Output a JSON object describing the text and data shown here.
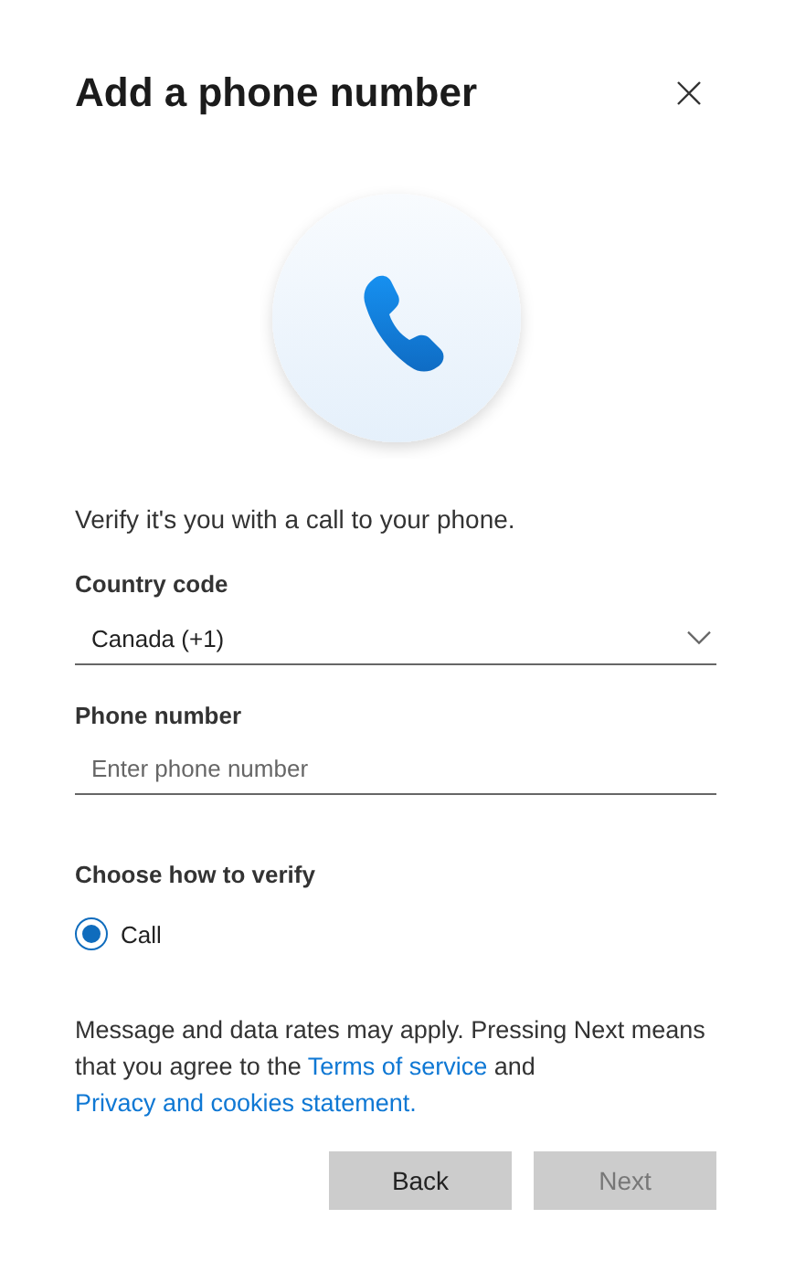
{
  "dialog": {
    "title": "Add a phone number"
  },
  "intro": "Verify it's you with a call to your phone.",
  "country": {
    "label": "Country code",
    "value": "Canada (+1)"
  },
  "phone": {
    "label": "Phone number",
    "placeholder": "Enter phone number"
  },
  "verify": {
    "label": "Choose how to verify",
    "options": [
      {
        "label": "Call",
        "selected": true
      }
    ]
  },
  "legal": [
    {
      "kind": "text",
      "text": "Message and data rates may apply. Pressing Next means that you agree to the "
    },
    {
      "kind": "link",
      "text": "Terms of service"
    },
    {
      "kind": "text",
      "text": " and "
    },
    {
      "kind": "link",
      "text": "Privacy and cookies statement."
    }
  ],
  "buttons": [
    {
      "label": "Back",
      "disabled": false
    },
    {
      "label": "Next",
      "disabled": true
    }
  ]
}
